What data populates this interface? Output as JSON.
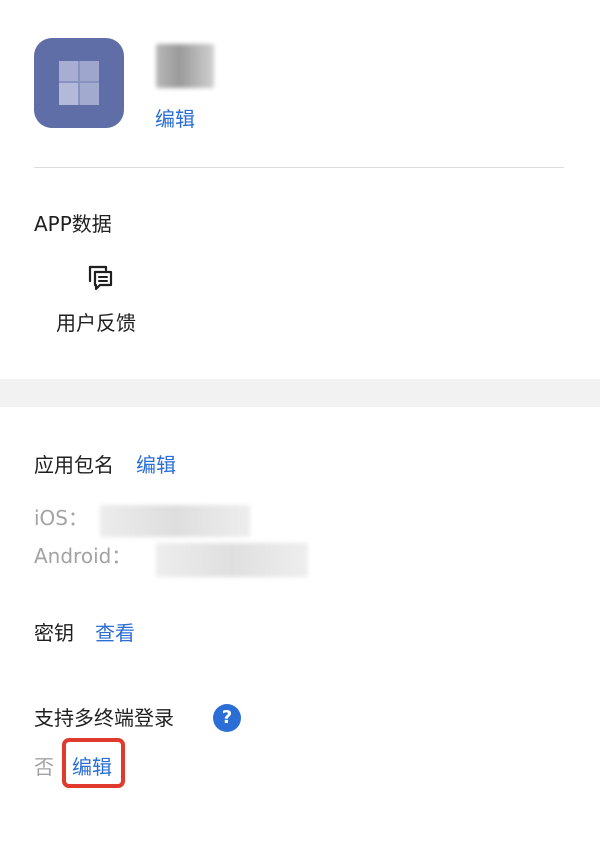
{
  "app": {
    "name": "",
    "edit_label": "编辑"
  },
  "app_data": {
    "title": "APP数据",
    "items": [
      {
        "label": "用户反馈",
        "icon": "chat-bubble-icon"
      }
    ]
  },
  "package_name": {
    "title": "应用包名",
    "edit_label": "编辑",
    "ios_label": "iOS：",
    "ios_value": "",
    "android_label": "Android：",
    "android_value": ""
  },
  "secret_key": {
    "title": "密钥",
    "view_label": "查看"
  },
  "multi_login": {
    "title": "支持多终端登录",
    "help_icon": "question-icon",
    "help_glyph": "?",
    "value": "否",
    "edit_label": "编辑"
  },
  "colors": {
    "accent": "#2b6fd6",
    "icon_bg": "#5f6ea6",
    "highlight": "#e03a2f",
    "section_band": "#f2f2f2"
  }
}
